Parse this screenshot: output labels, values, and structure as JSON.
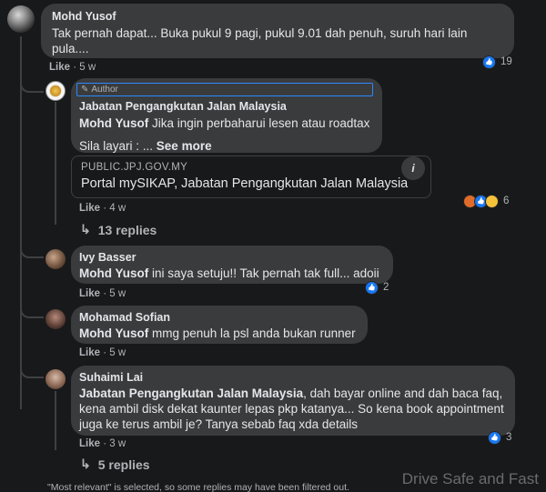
{
  "comments": [
    {
      "author": "Mohd Yusof",
      "text": "Tak pernah dapat... Buka pukul 9 pagi, pukul 9.01 dah penuh, suruh hari lain pula....",
      "like_label": "Like",
      "time": "5 w",
      "reaction_count": "19"
    },
    {
      "badge": "Author",
      "author": "Jabatan Pengangkutan Jalan Malaysia",
      "mention": "Mohd Yusof",
      "text": " Jika ingin perbaharui lesen atau roadtax",
      "text2": "Sila layari : ...",
      "see_more": "See more",
      "link_domain": "PUBLIC.JPJ.GOV.MY",
      "link_title": "Portal mySIKAP, Jabatan Pengangkutan Jalan Malaysia",
      "link_info": "i",
      "like_label": "Like",
      "time": "4 w",
      "reaction_count": "6",
      "replies": "13 replies"
    },
    {
      "author": "Ivy Basser",
      "mention": "Mohd Yusof",
      "text": " ini saya setuju!! Tak pernah tak full... adoii",
      "like_label": "Like",
      "time": "5 w",
      "reaction_count": "2"
    },
    {
      "author": "Mohamad Sofian",
      "mention": "Mohd Yusof",
      "text": " mmg penuh la psl anda bukan runner",
      "like_label": "Like",
      "time": "5 w"
    },
    {
      "author": "Suhaimi Lai",
      "mention": "Jabatan Pengangkutan Jalan Malaysia",
      "text": ", dah bayar online and dah baca faq, kena ambil disk dekat kaunter lepas pkp katanya... So kena book appointment juga ke terus ambil je? Tanya sebab faq xda details",
      "like_label": "Like",
      "time": "3 w",
      "reaction_count": "3",
      "replies": "5 replies"
    }
  ],
  "footer_note": "\"Most relevant\" is selected, so some replies may have been filtered out.",
  "watermark": "Drive Safe and Fast",
  "colors": {
    "background": "#18191a",
    "bubble": "#3a3b3c",
    "like_blue": "#1877f2",
    "author_badge_border": "#2d88ff"
  }
}
